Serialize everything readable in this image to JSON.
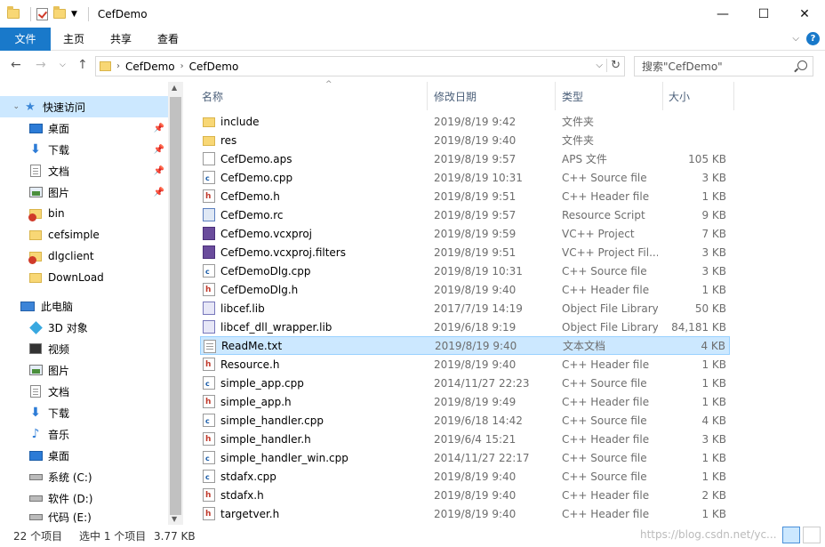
{
  "window": {
    "title": "CefDemo",
    "controls": {
      "minimize": "—",
      "maximize": "☐",
      "close": "✕"
    }
  },
  "ribbon": {
    "tabs": [
      "文件",
      "主页",
      "共享",
      "查看"
    ]
  },
  "address": {
    "breadcrumbs": [
      "CefDemo",
      "CefDemo"
    ],
    "search_placeholder": "搜索\"CefDemo\""
  },
  "sidebar": {
    "items": [
      {
        "label": "快速访问",
        "icon": "star-icon"
      },
      {
        "label": "桌面",
        "icon": "desktop-icon",
        "pinned": true
      },
      {
        "label": "下载",
        "icon": "download-icon",
        "pinned": true
      },
      {
        "label": "文档",
        "icon": "document-icon",
        "pinned": true
      },
      {
        "label": "图片",
        "icon": "picture-icon",
        "pinned": true
      },
      {
        "label": "bin",
        "icon": "folder-error-icon"
      },
      {
        "label": "cefsimple",
        "icon": "folder-icon"
      },
      {
        "label": "dlgclient",
        "icon": "folder-error-icon"
      },
      {
        "label": "DownLoad",
        "icon": "folder-icon"
      },
      {
        "label": "此电脑",
        "icon": "computer-icon"
      },
      {
        "label": "3D 对象",
        "icon": "3d-objects-icon"
      },
      {
        "label": "视频",
        "icon": "video-icon"
      },
      {
        "label": "图片",
        "icon": "picture-icon"
      },
      {
        "label": "文档",
        "icon": "document-icon"
      },
      {
        "label": "下载",
        "icon": "download-icon"
      },
      {
        "label": "音乐",
        "icon": "music-icon"
      },
      {
        "label": "桌面",
        "icon": "desktop-icon"
      },
      {
        "label": "系统 (C:)",
        "icon": "drive-icon"
      },
      {
        "label": "软件 (D:)",
        "icon": "drive-icon"
      },
      {
        "label": "代码 (E:)",
        "icon": "drive-icon"
      }
    ]
  },
  "columns": {
    "name": "名称",
    "date": "修改日期",
    "type": "类型",
    "size": "大小"
  },
  "files": [
    {
      "name": "include",
      "date": "2019/8/19 9:42",
      "type": "文件夹",
      "size": "",
      "icon": "folder"
    },
    {
      "name": "res",
      "date": "2019/8/19 9:40",
      "type": "文件夹",
      "size": "",
      "icon": "folder"
    },
    {
      "name": "CefDemo.aps",
      "date": "2019/8/19 9:57",
      "type": "APS 文件",
      "size": "105 KB",
      "icon": "file"
    },
    {
      "name": "CefDemo.cpp",
      "date": "2019/8/19 10:31",
      "type": "C++ Source file",
      "size": "3 KB",
      "icon": "cpp"
    },
    {
      "name": "CefDemo.h",
      "date": "2019/8/19 9:51",
      "type": "C++ Header file",
      "size": "1 KB",
      "icon": "h"
    },
    {
      "name": "CefDemo.rc",
      "date": "2019/8/19 9:57",
      "type": "Resource Script",
      "size": "9 KB",
      "icon": "rc"
    },
    {
      "name": "CefDemo.vcxproj",
      "date": "2019/8/19 9:59",
      "type": "VC++ Project",
      "size": "7 KB",
      "icon": "proj"
    },
    {
      "name": "CefDemo.vcxproj.filters",
      "date": "2019/8/19 9:51",
      "type": "VC++ Project Fil...",
      "size": "3 KB",
      "icon": "proj"
    },
    {
      "name": "CefDemoDlg.cpp",
      "date": "2019/8/19 10:31",
      "type": "C++ Source file",
      "size": "3 KB",
      "icon": "cpp"
    },
    {
      "name": "CefDemoDlg.h",
      "date": "2019/8/19 9:40",
      "type": "C++ Header file",
      "size": "1 KB",
      "icon": "h"
    },
    {
      "name": "libcef.lib",
      "date": "2017/7/19 14:19",
      "type": "Object File Library",
      "size": "50 KB",
      "icon": "lib"
    },
    {
      "name": "libcef_dll_wrapper.lib",
      "date": "2019/6/18 9:19",
      "type": "Object File Library",
      "size": "84,181 KB",
      "icon": "lib"
    },
    {
      "name": "ReadMe.txt",
      "date": "2019/8/19 9:40",
      "type": "文本文档",
      "size": "4 KB",
      "icon": "txt",
      "selected": true
    },
    {
      "name": "Resource.h",
      "date": "2019/8/19 9:40",
      "type": "C++ Header file",
      "size": "1 KB",
      "icon": "h"
    },
    {
      "name": "simple_app.cpp",
      "date": "2014/11/27 22:23",
      "type": "C++ Source file",
      "size": "1 KB",
      "icon": "cpp"
    },
    {
      "name": "simple_app.h",
      "date": "2019/8/19 9:49",
      "type": "C++ Header file",
      "size": "1 KB",
      "icon": "h"
    },
    {
      "name": "simple_handler.cpp",
      "date": "2019/6/18 14:42",
      "type": "C++ Source file",
      "size": "4 KB",
      "icon": "cpp"
    },
    {
      "name": "simple_handler.h",
      "date": "2019/6/4 15:21",
      "type": "C++ Header file",
      "size": "3 KB",
      "icon": "h"
    },
    {
      "name": "simple_handler_win.cpp",
      "date": "2014/11/27 22:17",
      "type": "C++ Source file",
      "size": "1 KB",
      "icon": "cpp"
    },
    {
      "name": "stdafx.cpp",
      "date": "2019/8/19 9:40",
      "type": "C++ Source file",
      "size": "1 KB",
      "icon": "cpp"
    },
    {
      "name": "stdafx.h",
      "date": "2019/8/19 9:40",
      "type": "C++ Header file",
      "size": "2 KB",
      "icon": "h"
    },
    {
      "name": "targetver.h",
      "date": "2019/8/19 9:40",
      "type": "C++ Header file",
      "size": "1 KB",
      "icon": "h"
    }
  ],
  "status": {
    "count": "22 个项目",
    "selected": "选中 1 个项目",
    "size": "3.77 KB",
    "watermark": "https://blog.csdn.net/yc..."
  },
  "colors": {
    "accent": "#1979ca",
    "selection": "#cce8ff"
  }
}
